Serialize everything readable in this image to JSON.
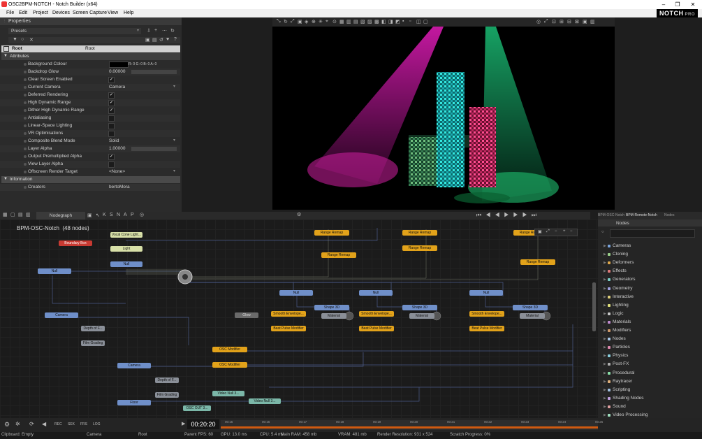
{
  "window": {
    "title": "OSC2BPM-NOTCH - Notch Builder (x64)",
    "minimize": "–",
    "maximize": "❐",
    "close": "✕"
  },
  "menu": [
    "File",
    "Edit",
    "Project",
    "Devices",
    "Screen Capture",
    "View",
    "Help"
  ],
  "logo": {
    "text": "NOTCH",
    "suffix": "PRO"
  },
  "properties": {
    "title": "Properties",
    "presets_label": "Presets",
    "root_label": "Root",
    "root_value": "Root",
    "attributes_header": "Attributes",
    "rows": [
      {
        "label": "Background Colour",
        "value": "R: 0 G: 0 B: 0 A: 0",
        "type": "color"
      },
      {
        "label": "Backdrop Glow",
        "value": "0.00000",
        "type": "num"
      },
      {
        "label": "Clear Screen Enabled",
        "value": "✓",
        "type": "check"
      },
      {
        "label": "Current Camera",
        "value": "Camera",
        "type": "drop"
      },
      {
        "label": "Deferred Rendering",
        "value": "✓",
        "type": "check"
      },
      {
        "label": "High Dynamic Range",
        "value": "✓",
        "type": "check"
      },
      {
        "label": "Dither High Dynamic Range",
        "value": "✓",
        "type": "check"
      },
      {
        "label": "Antialiasing",
        "value": "",
        "type": "check"
      },
      {
        "label": "Linear-Space Lighting",
        "value": "",
        "type": "check"
      },
      {
        "label": "VR Optimisations",
        "value": "",
        "type": "check"
      },
      {
        "label": "Composite Blend Mode",
        "value": "Solid",
        "type": "drop"
      },
      {
        "label": "Layer Alpha",
        "value": "1.00000",
        "type": "num"
      },
      {
        "label": "Output Premultiplied Alpha",
        "value": "✓",
        "type": "check"
      },
      {
        "label": "View Layer Alpha",
        "value": "",
        "type": "check"
      },
      {
        "label": "Offscreen Render Target",
        "value": "<None>",
        "type": "drop"
      }
    ],
    "information_header": "Information",
    "creators_label": "Creators",
    "creators_value": "bertoMora"
  },
  "nodegraph": {
    "tab": "Nodegraph",
    "toolbar_letters": [
      "K",
      "S",
      "N",
      "A",
      "P"
    ],
    "title": "BPM-OSC-Notch",
    "count": "(48 nodes)",
    "nodes": [
      {
        "label": "Boundary Box",
        "cls": "n-red"
      },
      {
        "label": "Vocal Cone Light...",
        "cls": "n-lime"
      },
      {
        "label": "Light",
        "cls": "n-lime"
      },
      {
        "label": "Null",
        "cls": "n-blue"
      },
      {
        "label": "Null",
        "cls": "n-blue"
      },
      {
        "label": "Camera",
        "cls": "n-blue"
      },
      {
        "label": "Depth of F...",
        "cls": "n-gray"
      },
      {
        "label": "Film Grading",
        "cls": "n-gray"
      },
      {
        "label": "Camera",
        "cls": "n-blue"
      },
      {
        "label": "Depth of F...",
        "cls": "n-gray"
      },
      {
        "label": "Film Grading",
        "cls": "n-gray"
      },
      {
        "label": "Floor",
        "cls": "n-blue"
      },
      {
        "label": "Glow",
        "cls": "n-dk"
      },
      {
        "label": "Range Remap",
        "cls": "n-yellow"
      },
      {
        "label": "Range Remap",
        "cls": "n-yellow"
      },
      {
        "label": "Range Remap",
        "cls": "n-yellow"
      },
      {
        "label": "Range Remap",
        "cls": "n-yellow"
      },
      {
        "label": "Range Remap",
        "cls": "n-yellow"
      },
      {
        "label": "Range Remap",
        "cls": "n-yellow"
      },
      {
        "label": "Null",
        "cls": "n-blue"
      },
      {
        "label": "Null",
        "cls": "n-blue"
      },
      {
        "label": "Null",
        "cls": "n-blue"
      },
      {
        "label": "Shape 3D",
        "cls": "n-blue"
      },
      {
        "label": "Shape 3D",
        "cls": "n-blue"
      },
      {
        "label": "Shape 3D",
        "cls": "n-blue"
      },
      {
        "label": "Material",
        "cls": "n-gray"
      },
      {
        "label": "Material",
        "cls": "n-gray"
      },
      {
        "label": "Material",
        "cls": "n-gray"
      },
      {
        "label": "Smooth Envelope...",
        "cls": "n-yellow"
      },
      {
        "label": "Smooth Envelope...",
        "cls": "n-yellow"
      },
      {
        "label": "Smooth Envelope...",
        "cls": "n-yellow"
      },
      {
        "label": "Beat Pulse Modifier",
        "cls": "n-yellow"
      },
      {
        "label": "Beat Pulse Modifier",
        "cls": "n-yellow"
      },
      {
        "label": "Beat Pulse Modifier",
        "cls": "n-yellow"
      },
      {
        "label": "OSC Modifier",
        "cls": "n-yellow"
      },
      {
        "label": "OSC Modifier",
        "cls": "n-yellow"
      },
      {
        "label": "Video Null 3...",
        "cls": "n-teal"
      },
      {
        "label": "Video Null 3...",
        "cls": "n-teal"
      },
      {
        "label": "OSC OUT 3...",
        "cls": "n-teal"
      }
    ]
  },
  "nodes_panel": {
    "tabs": [
      "BPM-OSC-Notch",
      "BPM-Remote-Notch",
      "Nodes"
    ],
    "header": "Nodes",
    "items": [
      "Cameras",
      "Cloning",
      "Deformers",
      "Effects",
      "Generators",
      "Geometry",
      "Interactive",
      "Lighting",
      "Logic",
      "Materials",
      "Modifiers",
      "Nodes",
      "Particles",
      "Physics",
      "Post-FX",
      "Procedural",
      "Raytracer",
      "Scripting",
      "Shading Nodes",
      "Sound",
      "Video Processing"
    ],
    "colors": [
      "#7aa6e0",
      "#9ad08a",
      "#e0a84a",
      "#e07a7a",
      "#7ad0c8",
      "#a0a0e0",
      "#e0d07a",
      "#e0e07a",
      "#c8c8c8",
      "#c08ad0",
      "#d09a6a",
      "#a8c8e8",
      "#e08ab0",
      "#8ad0e0",
      "#b0b0b0",
      "#8ae0a8",
      "#e0b07a",
      "#a0c0e0",
      "#c0a0e0",
      "#e0a0a0",
      "#a0e0c0"
    ]
  },
  "timeline": {
    "time": "00:20:20",
    "buttons": [
      "REC",
      "SEK",
      "FRS",
      "LOG"
    ],
    "ticks": [
      "00:15",
      "00:16",
      "00:17",
      "00:18",
      "00:19",
      "00:20",
      "00:21",
      "00:22",
      "00:23",
      "00:24",
      "00:25"
    ]
  },
  "status": [
    {
      "label": "Clipboard: Empty"
    },
    {
      "label": "Camera"
    },
    {
      "label": "Root"
    },
    {
      "label": "Parent  FPS: 60"
    },
    {
      "label": "GPU: 13.0 ms"
    },
    {
      "label": "CPU: 5.4 ms"
    },
    {
      "label": "Main RAM: 458 mb"
    },
    {
      "label": "VRAM: 481 mb"
    },
    {
      "label": "Render Resolution: 931 x 524"
    },
    {
      "label": "Scratch Progress: 0%"
    }
  ]
}
